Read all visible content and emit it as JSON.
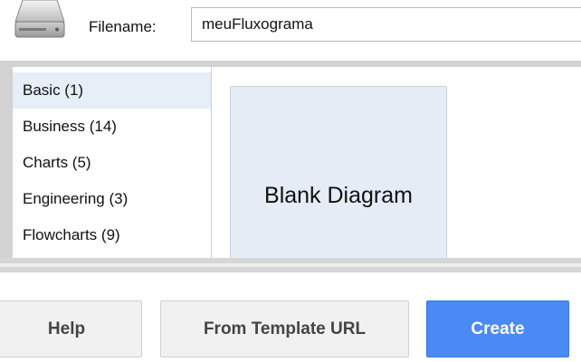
{
  "header": {
    "filename_label": "Filename:",
    "filename_value": "meuFluxograma"
  },
  "categories": [
    {
      "label": "Basic (1)",
      "selected": true
    },
    {
      "label": "Business (14)",
      "selected": false
    },
    {
      "label": "Charts (5)",
      "selected": false
    },
    {
      "label": "Engineering (3)",
      "selected": false
    },
    {
      "label": "Flowcharts (9)",
      "selected": false
    }
  ],
  "templates": [
    {
      "label": "Blank Diagram"
    }
  ],
  "buttons": {
    "help": "Help",
    "from_template_url": "From Template URL",
    "create": "Create"
  },
  "colors": {
    "accent": "#4a8af4",
    "selected_category": "#e6eef8",
    "template_card": "#e5ecf5"
  },
  "icons": {
    "file": "hard-drive-icon"
  }
}
